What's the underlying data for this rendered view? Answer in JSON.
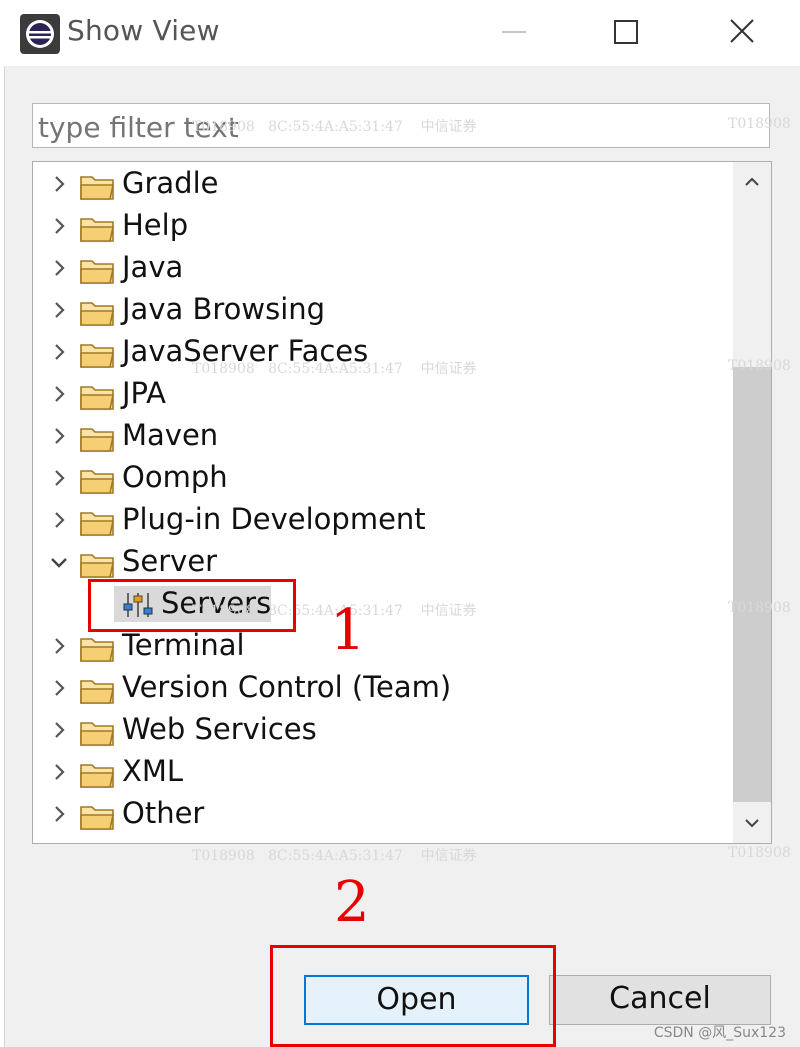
{
  "window": {
    "title": "Show View"
  },
  "filter": {
    "placeholder": "type filter text"
  },
  "tree": {
    "items": [
      {
        "label": "Gradle",
        "expanded": false
      },
      {
        "label": "Help",
        "expanded": false
      },
      {
        "label": "Java",
        "expanded": false
      },
      {
        "label": "Java Browsing",
        "expanded": false
      },
      {
        "label": "JavaServer Faces",
        "expanded": false
      },
      {
        "label": "JPA",
        "expanded": false
      },
      {
        "label": "Maven",
        "expanded": false
      },
      {
        "label": "Oomph",
        "expanded": false
      },
      {
        "label": "Plug-in Development",
        "expanded": false
      },
      {
        "label": "Server",
        "expanded": true,
        "children": [
          {
            "label": "Servers",
            "selected": true
          }
        ]
      },
      {
        "label": "Terminal",
        "expanded": false
      },
      {
        "label": "Version Control (Team)",
        "expanded": false
      },
      {
        "label": "Web Services",
        "expanded": false
      },
      {
        "label": "XML",
        "expanded": false
      },
      {
        "label": "Other",
        "expanded": false
      }
    ]
  },
  "buttons": {
    "open_label": "Open",
    "cancel_label": "Cancel"
  },
  "annotations": {
    "step1": "1",
    "step2": "2"
  },
  "watermarks": [
    "T018908",
    "8C:55:4A:A5:31:47",
    "中信证券"
  ],
  "footer": {
    "csdn_mark": "CSDN @风_Sux123"
  },
  "colors": {
    "annotation": "#e80000",
    "open_button_border": "#0078d7",
    "folder": "#e8b04a"
  }
}
